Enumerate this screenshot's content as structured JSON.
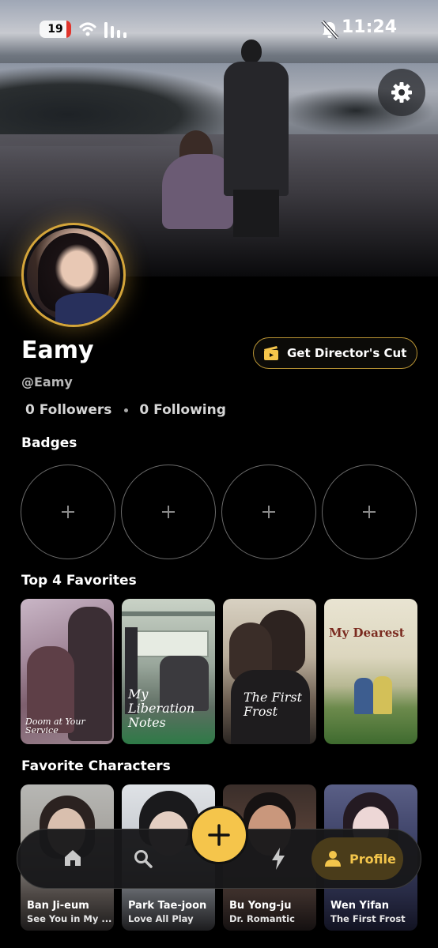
{
  "status_bar": {
    "battery": "19",
    "time": "11:24"
  },
  "profile": {
    "name": "Eamy",
    "handle": "@Eamy",
    "followers": "0 Followers",
    "following": "0 Following",
    "director_cut_label": "Get Director's Cut"
  },
  "sections": {
    "badges": "Badges",
    "favorites": "Top 4 Favorites",
    "characters": "Favorite Characters"
  },
  "badges": [
    "+",
    "+",
    "+",
    "+"
  ],
  "favorites": [
    {
      "title": "Doom at Your Service"
    },
    {
      "title": "My Liberation Notes"
    },
    {
      "title": "The First Frost"
    },
    {
      "title": "My Dearest"
    }
  ],
  "characters": [
    {
      "name": "Ban Ji-eum",
      "show": "See You in My ..."
    },
    {
      "name": "Park Tae-joon",
      "show": "Love All Play"
    },
    {
      "name": "Bu Yong-ju",
      "show": "Dr. Romantic"
    },
    {
      "name": "Wen Yifan",
      "show": "The First Frost"
    }
  ],
  "nav": {
    "home_icon": "home-icon",
    "search_icon": "search-icon",
    "add_icon": "plus-icon",
    "activity_icon": "bolt-icon",
    "profile_label": "Profile"
  },
  "colors": {
    "accent": "#f5c54b",
    "gold_border": "#d4a53a",
    "background": "#000000"
  }
}
